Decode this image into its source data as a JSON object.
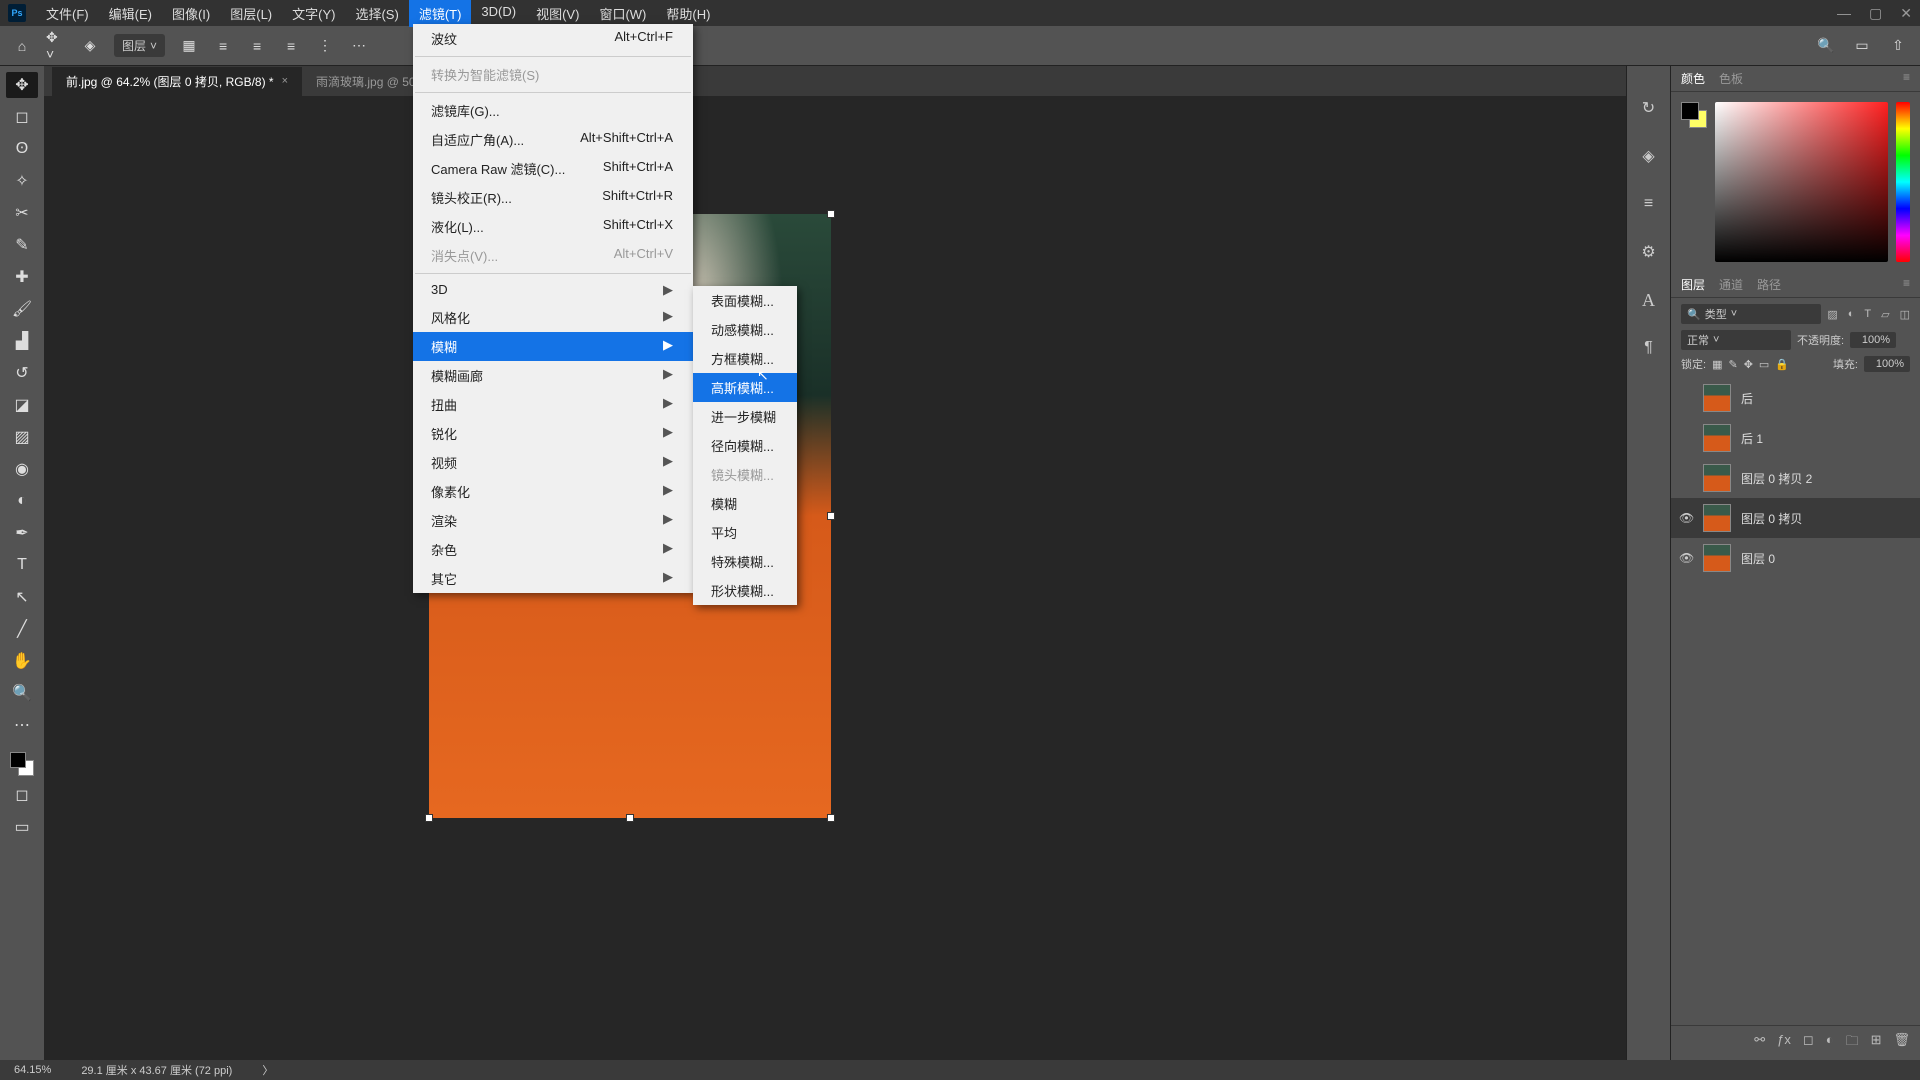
{
  "menubar": [
    "文件(F)",
    "编辑(E)",
    "图像(I)",
    "图层(L)",
    "文字(Y)",
    "选择(S)",
    "滤镜(T)",
    "3D(D)",
    "视图(V)",
    "窗口(W)",
    "帮助(H)"
  ],
  "active_menu_index": 6,
  "optbar": {
    "layer_sel": "图层"
  },
  "tabs": [
    {
      "label": "前.jpg @ 64.2% (图层 0 拷贝, RGB/8) *",
      "active": true
    },
    {
      "label": "雨滴玻璃.jpg @ 50% ...",
      "active": false
    }
  ],
  "dropdown1": [
    {
      "label": "波纹",
      "shortcut": "Alt+Ctrl+F"
    },
    {
      "sep": true
    },
    {
      "label": "转换为智能滤镜(S)",
      "disabled": true
    },
    {
      "sep": true
    },
    {
      "label": "滤镜库(G)..."
    },
    {
      "label": "自适应广角(A)...",
      "shortcut": "Alt+Shift+Ctrl+A"
    },
    {
      "label": "Camera Raw 滤镜(C)...",
      "shortcut": "Shift+Ctrl+A"
    },
    {
      "label": "镜头校正(R)...",
      "shortcut": "Shift+Ctrl+R"
    },
    {
      "label": "液化(L)...",
      "shortcut": "Shift+Ctrl+X"
    },
    {
      "label": "消失点(V)...",
      "shortcut": "Alt+Ctrl+V",
      "disabled": true
    },
    {
      "sep": true
    },
    {
      "label": "3D",
      "submenu": true
    },
    {
      "label": "风格化",
      "submenu": true
    },
    {
      "label": "模糊",
      "submenu": true,
      "hl": true
    },
    {
      "label": "模糊画廊",
      "submenu": true
    },
    {
      "label": "扭曲",
      "submenu": true
    },
    {
      "label": "锐化",
      "submenu": true
    },
    {
      "label": "视频",
      "submenu": true
    },
    {
      "label": "像素化",
      "submenu": true
    },
    {
      "label": "渲染",
      "submenu": true
    },
    {
      "label": "杂色",
      "submenu": true
    },
    {
      "label": "其它",
      "submenu": true
    }
  ],
  "dropdown2": [
    {
      "label": "表面模糊..."
    },
    {
      "label": "动感模糊..."
    },
    {
      "label": "方框模糊..."
    },
    {
      "label": "高斯模糊...",
      "hl": true
    },
    {
      "label": "进一步模糊"
    },
    {
      "label": "径向模糊..."
    },
    {
      "label": "镜头模糊...",
      "disabled": true
    },
    {
      "label": "模糊"
    },
    {
      "label": "平均"
    },
    {
      "label": "特殊模糊..."
    },
    {
      "label": "形状模糊..."
    }
  ],
  "panels": {
    "color_tabs": [
      "颜色",
      "色板"
    ],
    "layers_tabs": [
      "图层",
      "通道",
      "路径"
    ],
    "filter_label": "类型",
    "blend_mode": "正常",
    "opacity_label": "不透明度:",
    "opacity_val": "100%",
    "lock_label": "锁定:",
    "fill_label": "填充:",
    "fill_val": "100%"
  },
  "layers": [
    {
      "name": "后",
      "visible": false
    },
    {
      "name": "后 1",
      "visible": false
    },
    {
      "name": "图层 0 拷贝 2",
      "visible": false
    },
    {
      "name": "图层 0 拷贝",
      "visible": true,
      "active": true
    },
    {
      "name": "图层 0",
      "visible": true
    }
  ],
  "status": {
    "zoom": "64.15%",
    "dims": "29.1 厘米 x 43.67 厘米 (72 ppi)"
  }
}
